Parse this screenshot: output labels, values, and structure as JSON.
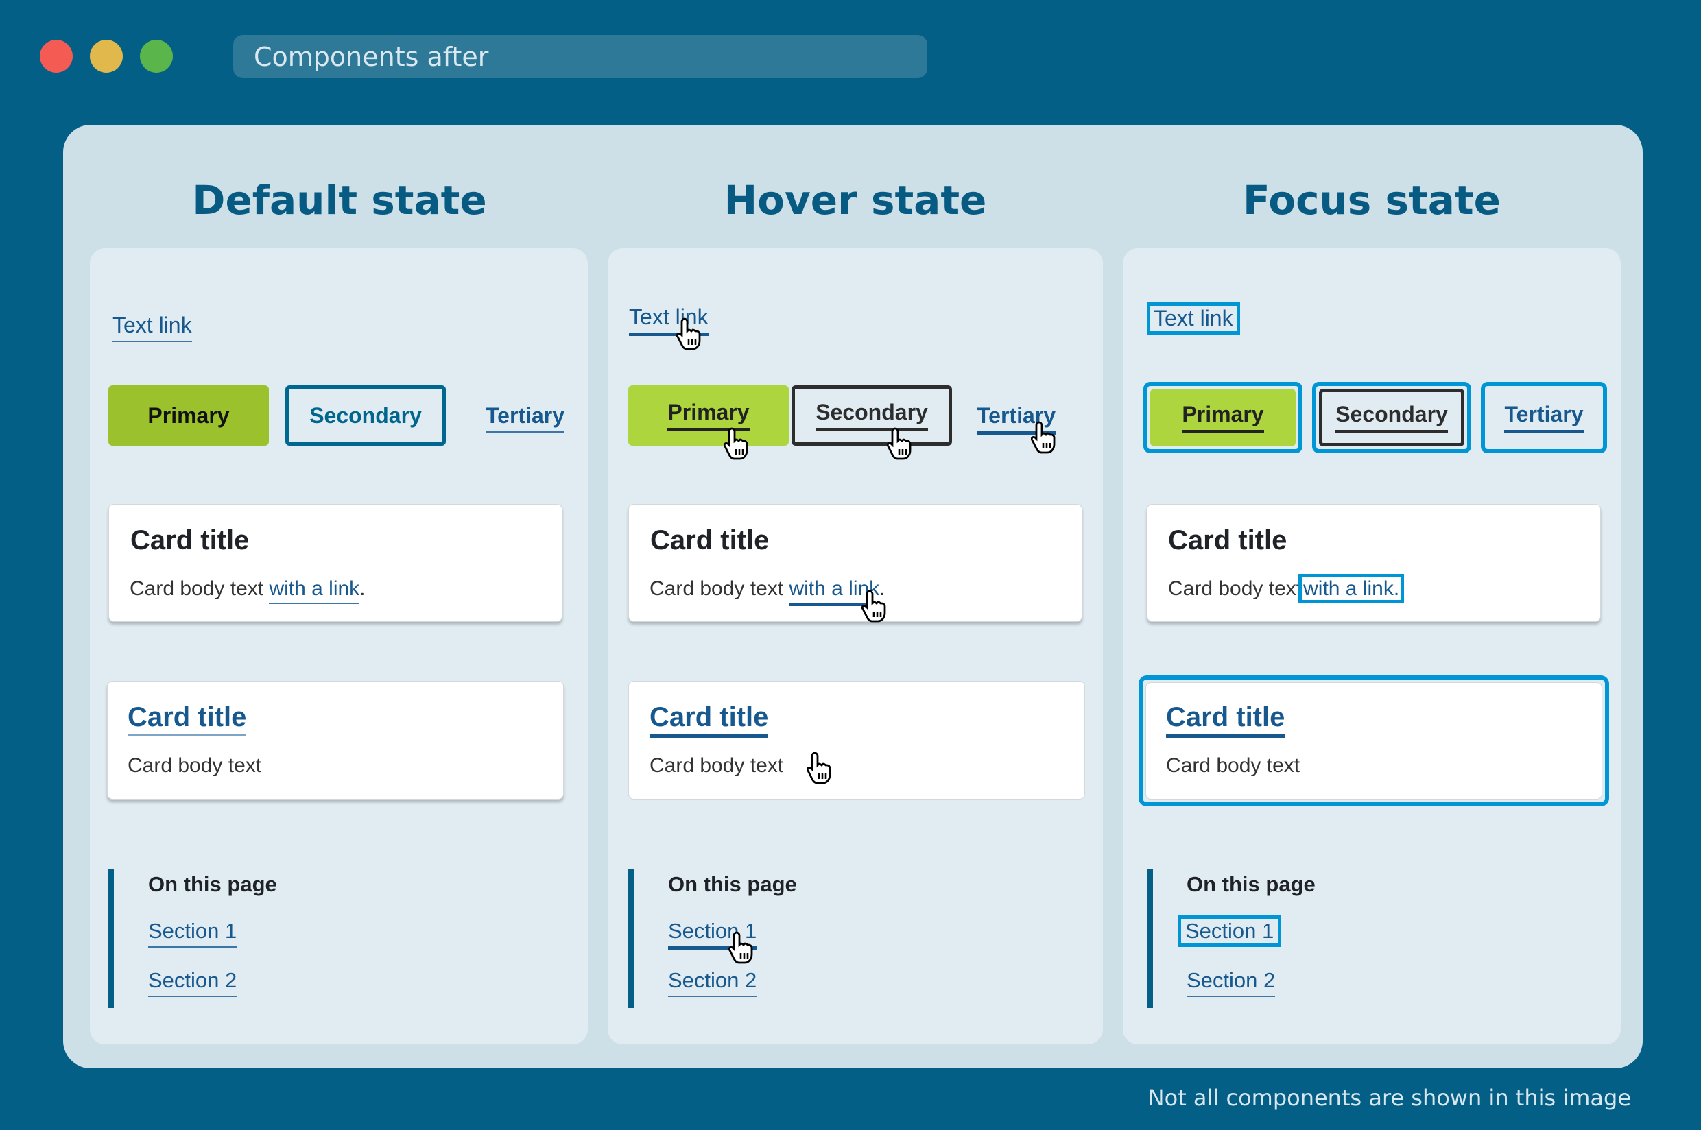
{
  "window": {
    "title": "Components after",
    "controls": [
      {
        "name": "close",
        "color": "#f45c53"
      },
      {
        "name": "minimize",
        "color": "#e1b84b"
      },
      {
        "name": "maximize",
        "color": "#5ab64a"
      }
    ]
  },
  "columns": [
    {
      "heading": "Default state",
      "text_link": "Text link",
      "buttons": {
        "primary": "Primary",
        "secondary": "Secondary",
        "tertiary": "Tertiary"
      },
      "card1": {
        "title": "Card title",
        "body": "Card body text",
        "link": "with a link",
        "suffix": "."
      },
      "card2": {
        "title": "Card title",
        "body": "Card body text"
      },
      "on_this_page": {
        "heading": "On this page",
        "items": [
          "Section 1",
          "Section 2"
        ]
      }
    },
    {
      "heading": "Hover state",
      "text_link": "Text link",
      "buttons": {
        "primary": "Primary",
        "secondary": "Secondary",
        "tertiary": "Tertiary"
      },
      "card1": {
        "title": "Card title",
        "body": "Card body text",
        "link": "with a link",
        "suffix": "."
      },
      "card2": {
        "title": "Card title",
        "body": "Card body text"
      },
      "on_this_page": {
        "heading": "On this page",
        "items": [
          "Section 1",
          "Section 2"
        ]
      }
    },
    {
      "heading": "Focus state",
      "text_link": "Text link",
      "buttons": {
        "primary": "Primary",
        "secondary": "Secondary",
        "tertiary": "Tertiary"
      },
      "card1": {
        "title": "Card title",
        "body": "Card body text",
        "link": "with a link",
        "suffix": "."
      },
      "card2": {
        "title": "Card title",
        "body": "Card body text"
      },
      "on_this_page": {
        "heading": "On this page",
        "items": [
          "Section 1",
          "Section 2"
        ]
      }
    }
  ],
  "colors": {
    "background": "#035f86",
    "panel": "#cddfe7",
    "column": "#e0ecf2",
    "primary_default": "#9bc12d",
    "primary_hover": "#add63e",
    "link": "#17588e",
    "focus_ring": "#0096d6",
    "dark": "#2d2d2d"
  },
  "footnote": "Not all components are shown in this image"
}
